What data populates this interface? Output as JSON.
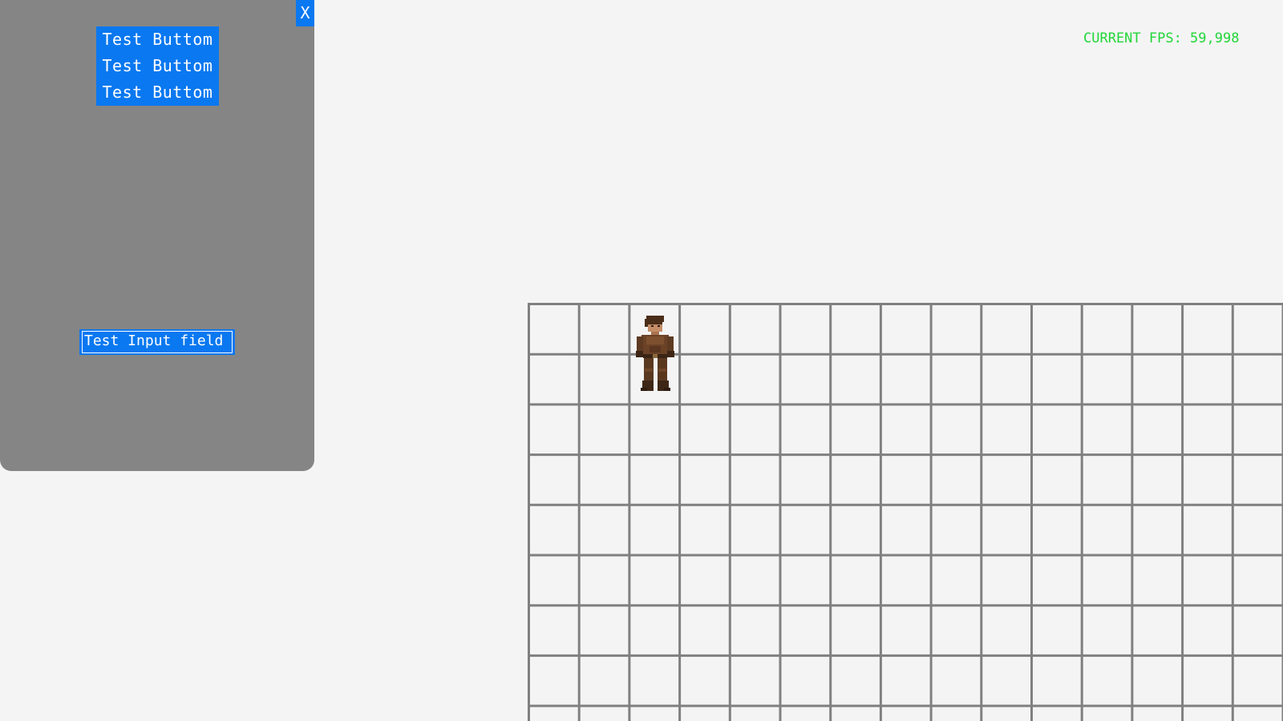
{
  "panel": {
    "close_label": "X",
    "buttons": [
      {
        "label": "Test Buttom"
      },
      {
        "label": "Test Buttom"
      },
      {
        "label": "Test Buttom"
      }
    ],
    "input_value": "Test Input field"
  },
  "hud": {
    "fps_text": "CURRENT FPS: 59,998"
  },
  "colors": {
    "accent": "#0a78f0",
    "panel_bg": "#858585",
    "fps_text": "#22d63a",
    "grid_line": "#808080",
    "background": "#f4f4f4"
  },
  "game": {
    "character": "character-sprite"
  }
}
